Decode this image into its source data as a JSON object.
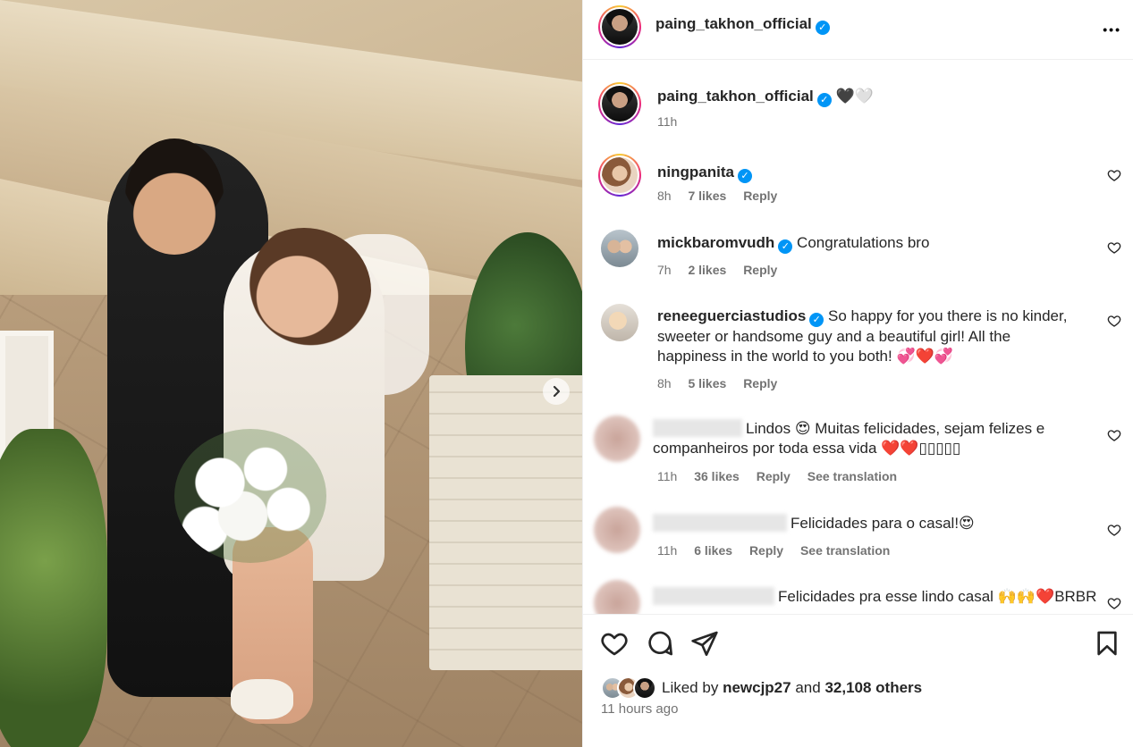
{
  "post": {
    "author": "paing_takhon_official",
    "next_icon": "chevron-right-icon"
  },
  "header": {
    "username": "paing_takhon_official",
    "more_icon": "more-horizontal-icon",
    "more_label": "•••"
  },
  "caption": {
    "username": "paing_takhon_official",
    "text": "🖤🤍",
    "time": "11h"
  },
  "comments": [
    {
      "username": "ningpanita",
      "verified": true,
      "text": "",
      "time": "8h",
      "likes": "7 likes",
      "reply": "Reply"
    },
    {
      "username": "mickbaromvudh",
      "verified": true,
      "text": "Congratulations bro",
      "time": "7h",
      "likes": "2 likes",
      "reply": "Reply"
    },
    {
      "username": "reneeguerciastudios",
      "verified": true,
      "text": "So happy for you there is no kinder, sweeter or handsome guy and a beautiful girl! All the happiness in the world to you both! 💞❤️💞",
      "time": "8h",
      "likes": "5 likes",
      "reply": "Reply"
    },
    {
      "username": "",
      "verified": false,
      "text": "Lindos 😍 Muitas felicidades, sejam felizes e companheiros por toda essa vida ❤️❤️▯▯▯▯▯",
      "time": "11h",
      "likes": "36 likes",
      "reply": "Reply",
      "translate": "See translation"
    },
    {
      "username": "",
      "verified": false,
      "text": "Felicidades para o casal!😍",
      "time": "11h",
      "likes": "6 likes",
      "reply": "Reply",
      "translate": "See translation"
    },
    {
      "username": "",
      "verified": false,
      "text": "Felicidades pra esse lindo casal 🙌🙌❤️BRBR",
      "time": "",
      "likes": "",
      "reply": ""
    }
  ],
  "actions": {
    "like_icon": "heart-icon",
    "comment_icon": "comment-icon",
    "share_icon": "share-icon",
    "save_icon": "bookmark-icon"
  },
  "likes": {
    "prefix": "Liked by",
    "user": "newcjp27",
    "and": "and",
    "others": "32,108 others"
  },
  "posted": "11 hours ago",
  "colors": {
    "verified": "#0095f6",
    "meta": "#737373",
    "text": "#262626",
    "heart": "#e0241b"
  }
}
